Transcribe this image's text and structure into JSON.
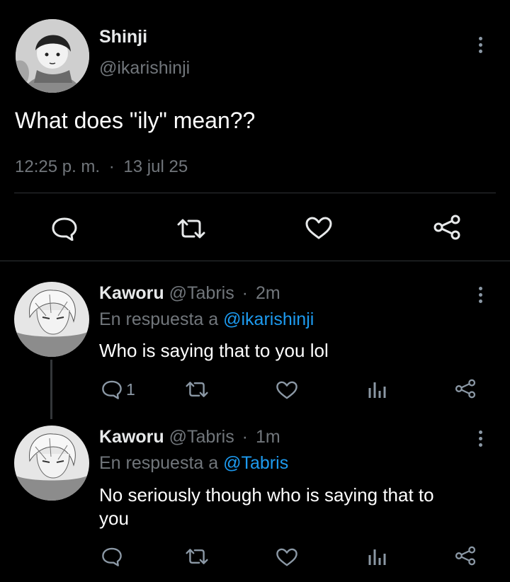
{
  "main_tweet": {
    "display_name": "Shinji",
    "handle": "@ikarishinji",
    "text": "What does \"ily\" mean??",
    "time": "12:25 p. m.",
    "separator": "·",
    "date": "13 jul 25"
  },
  "replies": [
    {
      "display_name": "Kaworu",
      "handle": "@Tabris",
      "separator": "·",
      "age": "2m",
      "reply_prefix": "En respuesta a",
      "reply_to": "@ikarishinji",
      "text": "Who is saying that to you lol",
      "reply_count": "1"
    },
    {
      "display_name": "Kaworu",
      "handle": "@Tabris",
      "separator": "·",
      "age": "1m",
      "reply_prefix": "En respuesta a",
      "reply_to": "@Tabris",
      "text_line1": "No seriously though who is saying that to",
      "text_line2": "you"
    }
  ],
  "icons": [
    "comment-icon",
    "retweet-icon",
    "heart-icon",
    "share-icon",
    "views-icon",
    "more-icon"
  ],
  "colors": {
    "background": "#000000",
    "text": "#e7e9ea",
    "muted": "#71767b",
    "link": "#1d9bf0",
    "divider": "#2f3336"
  }
}
